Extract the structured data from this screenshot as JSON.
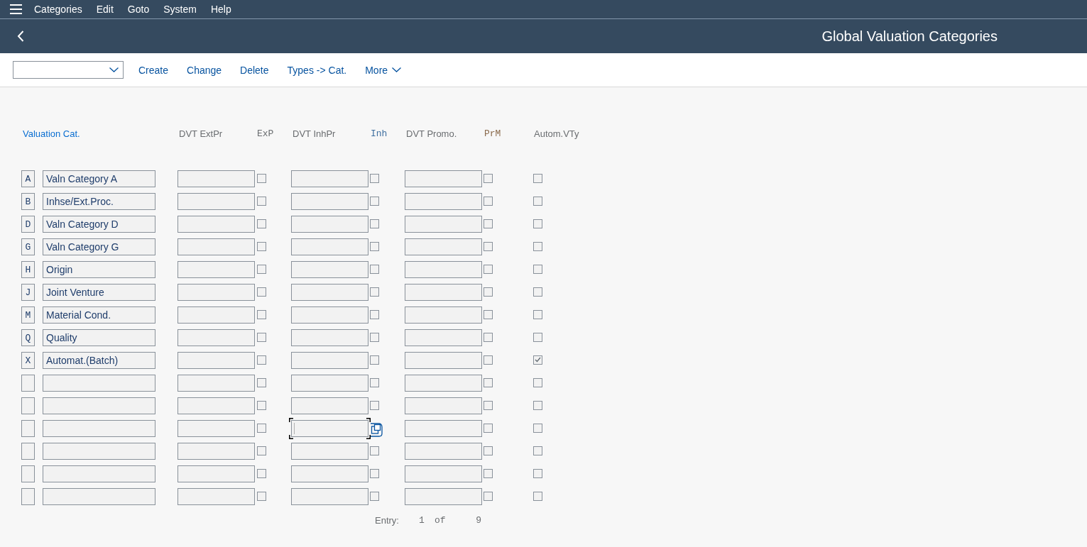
{
  "menu_bar": {
    "items": [
      "Categories",
      "Edit",
      "Goto",
      "System",
      "Help"
    ]
  },
  "header": {
    "title": "Global Valuation Categories"
  },
  "toolbar": {
    "buttons": [
      "Create",
      "Change",
      "Delete",
      "Types -> Cat."
    ],
    "more": "More"
  },
  "table": {
    "columns": [
      {
        "label": "Valuation Cat.",
        "kind": "text",
        "color": "#0a6ed1"
      },
      {
        "label": "DVT ExtPr",
        "kind": "text",
        "color": "#6a6d70"
      },
      {
        "label": "ExP",
        "kind": "code",
        "color": "#6a6d70"
      },
      {
        "label": "DVT InhPr",
        "kind": "text",
        "color": "#6a6d70"
      },
      {
        "label": "Inh",
        "kind": "code",
        "color": "#3f6fa0"
      },
      {
        "label": "DVT Promo.",
        "kind": "text",
        "color": "#6a6d70"
      },
      {
        "label": "PrM",
        "kind": "code",
        "color": "#8a6a4c"
      },
      {
        "label": "Autom.VTy",
        "kind": "text",
        "color": "#6a6d70"
      }
    ],
    "rows": [
      {
        "key": "A",
        "name": "Valn Category A",
        "exp": false,
        "inh": false,
        "prm": false,
        "autom": false,
        "inh_focused": false
      },
      {
        "key": "B",
        "name": "Inhse/Ext.Proc.",
        "exp": false,
        "inh": false,
        "prm": false,
        "autom": false,
        "inh_focused": false
      },
      {
        "key": "D",
        "name": "Valn Category D",
        "exp": false,
        "inh": false,
        "prm": false,
        "autom": false,
        "inh_focused": false
      },
      {
        "key": "G",
        "name": "Valn Category G",
        "exp": false,
        "inh": false,
        "prm": false,
        "autom": false,
        "inh_focused": false
      },
      {
        "key": "H",
        "name": "Origin",
        "exp": false,
        "inh": false,
        "prm": false,
        "autom": false,
        "inh_focused": false
      },
      {
        "key": "J",
        "name": "Joint Venture",
        "exp": false,
        "inh": false,
        "prm": false,
        "autom": false,
        "inh_focused": false
      },
      {
        "key": "M",
        "name": "Material Cond.",
        "exp": false,
        "inh": false,
        "prm": false,
        "autom": false,
        "inh_focused": false
      },
      {
        "key": "Q",
        "name": "Quality",
        "exp": false,
        "inh": false,
        "prm": false,
        "autom": false,
        "inh_focused": false
      },
      {
        "key": "X",
        "name": "Automat.(Batch)",
        "exp": false,
        "inh": false,
        "prm": false,
        "autom": true,
        "inh_focused": false
      },
      {
        "exp": false,
        "inh": false,
        "prm": false,
        "autom": false,
        "inh_focused": false
      },
      {
        "exp": false,
        "inh": false,
        "prm": false,
        "autom": false,
        "inh_focused": false
      },
      {
        "exp": false,
        "prm": false,
        "autom": false,
        "inh_focused": true
      },
      {
        "exp": false,
        "inh": false,
        "prm": false,
        "autom": false,
        "inh_focused": false
      },
      {
        "exp": false,
        "inh": false,
        "prm": false,
        "autom": false,
        "inh_focused": false
      },
      {
        "exp": false,
        "inh": false,
        "prm": false,
        "autom": false,
        "inh_focused": false
      }
    ]
  },
  "footer": {
    "label": "Entry:",
    "current": "1",
    "separator": "of",
    "total": "9"
  }
}
